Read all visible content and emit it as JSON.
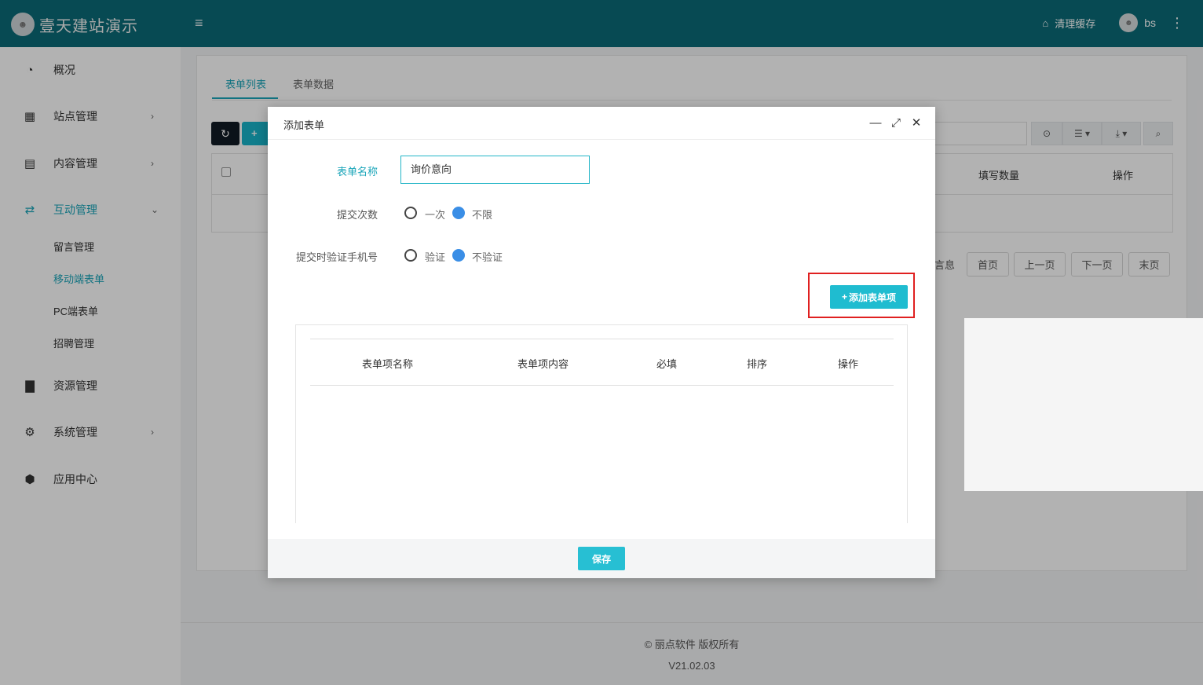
{
  "app": {
    "brand": "壹天建站演示",
    "logo_glyph": "☻"
  },
  "header": {
    "menu_icon": "≡",
    "clear_cache_label": "清理缓存",
    "clear_icon": "⌂",
    "user_name": "bs",
    "kebab": "⋮"
  },
  "sidebar": {
    "items": [
      {
        "label": "概况",
        "icon": "◔"
      },
      {
        "label": "站点管理",
        "icon": "▦",
        "chevron": "›"
      },
      {
        "label": "内容管理",
        "icon": "▤",
        "chevron": "›"
      },
      {
        "label": "互动管理",
        "icon": "⇄",
        "chevron": "⌄"
      },
      {
        "label": "资源管理",
        "icon": "▇"
      },
      {
        "label": "系统管理",
        "icon": "⚙",
        "chevron": "›"
      },
      {
        "label": "应用中心",
        "icon": "⬢"
      }
    ],
    "sub_items": [
      {
        "label": "留言管理"
      },
      {
        "label": "移动端表单"
      },
      {
        "label": "PC端表单"
      },
      {
        "label": "招聘管理"
      }
    ]
  },
  "main": {
    "tabs": [
      {
        "label": "表单列表"
      },
      {
        "label": "表单数据"
      }
    ],
    "refresh_icon": "↻",
    "add_peek": "+",
    "toolbar_icons": {
      "columns": "⊙",
      "list": "☰ ▾",
      "export": "⤓ ▾",
      "search": "⌕"
    },
    "table_columns": [
      "填写数量",
      "操作"
    ],
    "pager": {
      "info_fragment": "言息",
      "first": "首页",
      "prev": "上一页",
      "next": "下一页",
      "last": "末页"
    }
  },
  "footer": {
    "copyright": "© 丽点软件 版权所有",
    "version": "V21.02.03"
  },
  "modal": {
    "title": "添加表单",
    "minimize": "—",
    "maximize": "⤢",
    "close": "✕",
    "name_label": "表单名称",
    "name_value": "询价意向",
    "submit_times_label": "提交次数",
    "submit_times_options": [
      "一次",
      "不限"
    ],
    "submit_times_selected": "不限",
    "verify_label": "提交时验证手机号",
    "verify_options": [
      "验证",
      "不验证"
    ],
    "verify_selected": "不验证",
    "add_item_button": "添加表单项",
    "add_item_icon": "+",
    "item_columns": [
      "表单项名称",
      "表单项内容",
      "必填",
      "排序",
      "操作"
    ],
    "save_button": "保存"
  },
  "colors": {
    "topbar": "#0b6b77",
    "accent": "#1aa5b9",
    "button": "#1fbcd0",
    "radio_selected": "#3a8ee6",
    "highlight": "#e02020"
  }
}
